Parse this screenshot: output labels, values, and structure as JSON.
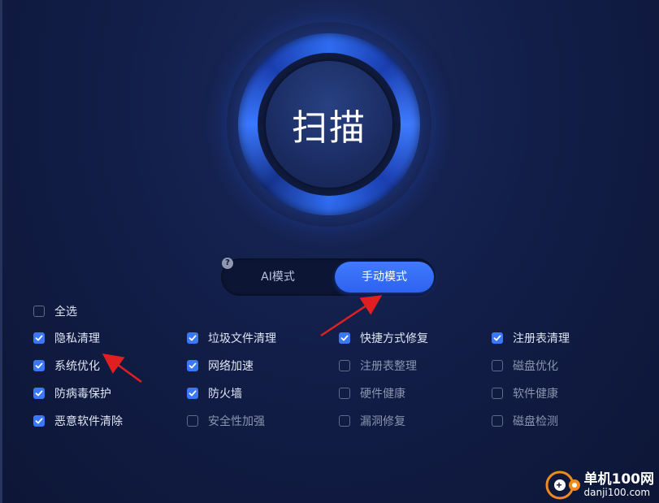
{
  "scan_button": {
    "label": "扫描"
  },
  "mode_toggle": {
    "ai_label": "AI模式",
    "manual_label": "手动模式",
    "selected": "手动模式",
    "help_icon": "?"
  },
  "select_all": {
    "label": "全选",
    "checked": false
  },
  "options": [
    {
      "label": "隐私清理",
      "checked": true
    },
    {
      "label": "垃圾文件清理",
      "checked": true
    },
    {
      "label": "快捷方式修复",
      "checked": true
    },
    {
      "label": "注册表清理",
      "checked": true
    },
    {
      "label": "系统优化",
      "checked": true
    },
    {
      "label": "网络加速",
      "checked": true
    },
    {
      "label": "注册表整理",
      "checked": false
    },
    {
      "label": "磁盘优化",
      "checked": false
    },
    {
      "label": "防病毒保护",
      "checked": true
    },
    {
      "label": "防火墙",
      "checked": true
    },
    {
      "label": "硬件健康",
      "checked": false
    },
    {
      "label": "软件健康",
      "checked": false
    },
    {
      "label": "恶意软件清除",
      "checked": true
    },
    {
      "label": "安全性加强",
      "checked": false
    },
    {
      "label": "漏洞修复",
      "checked": false
    },
    {
      "label": "磁盘检测",
      "checked": false
    }
  ],
  "watermark": {
    "title": "单机100网",
    "url": "danji100.com"
  },
  "colors": {
    "accent": "#3b78f7",
    "background": "#121e48",
    "arrow": "#e02020"
  }
}
